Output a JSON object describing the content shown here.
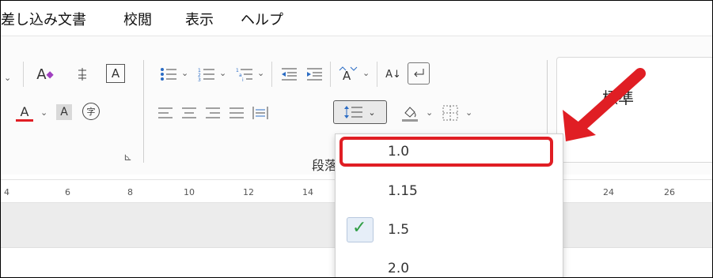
{
  "menu": [
    "差し込み文書",
    "校閲",
    "表示",
    "ヘルプ"
  ],
  "ribbon": {
    "paragraph_group_label": "段落",
    "style_name": "標準",
    "icons": {
      "row1": [
        "phonetic-guide-icon",
        "enclosed-char-icon",
        "char-border-icon",
        "bullets-icon",
        "numbering-icon",
        "multilevel-list-icon",
        "decrease-indent-icon",
        "increase-indent-icon",
        "text-direction-icon",
        "sort-icon",
        "show-marks-icon"
      ],
      "row2": [
        "font-color-icon",
        "char-shading-icon",
        "enclosed-circle-icon",
        "align-left-icon",
        "align-center-icon",
        "align-right-icon",
        "justify-icon",
        "distributed-icon",
        "line-spacing-icon",
        "shading-icon",
        "borders-icon"
      ]
    },
    "glyphs": {
      "chev": "⌄",
      "phonetic": "A",
      "char_border": "A",
      "font_color": "A",
      "shading_a": "A",
      "enclosed": "字",
      "sort": "A↓",
      "launcher": "⊾"
    }
  },
  "ruler": {
    "ticks": [
      "4",
      "6",
      "8",
      "10",
      "12",
      "14",
      "24",
      "26"
    ]
  },
  "dropdown": {
    "options": [
      "1.0",
      "1.15",
      "1.5",
      "2.0"
    ],
    "checked": "1.5",
    "highlighted": "1.0",
    "check_glyph": "✓"
  },
  "colors": {
    "highlight": "#e01e24",
    "accent_red": "#e01e24",
    "check_green": "#2f9e44"
  }
}
